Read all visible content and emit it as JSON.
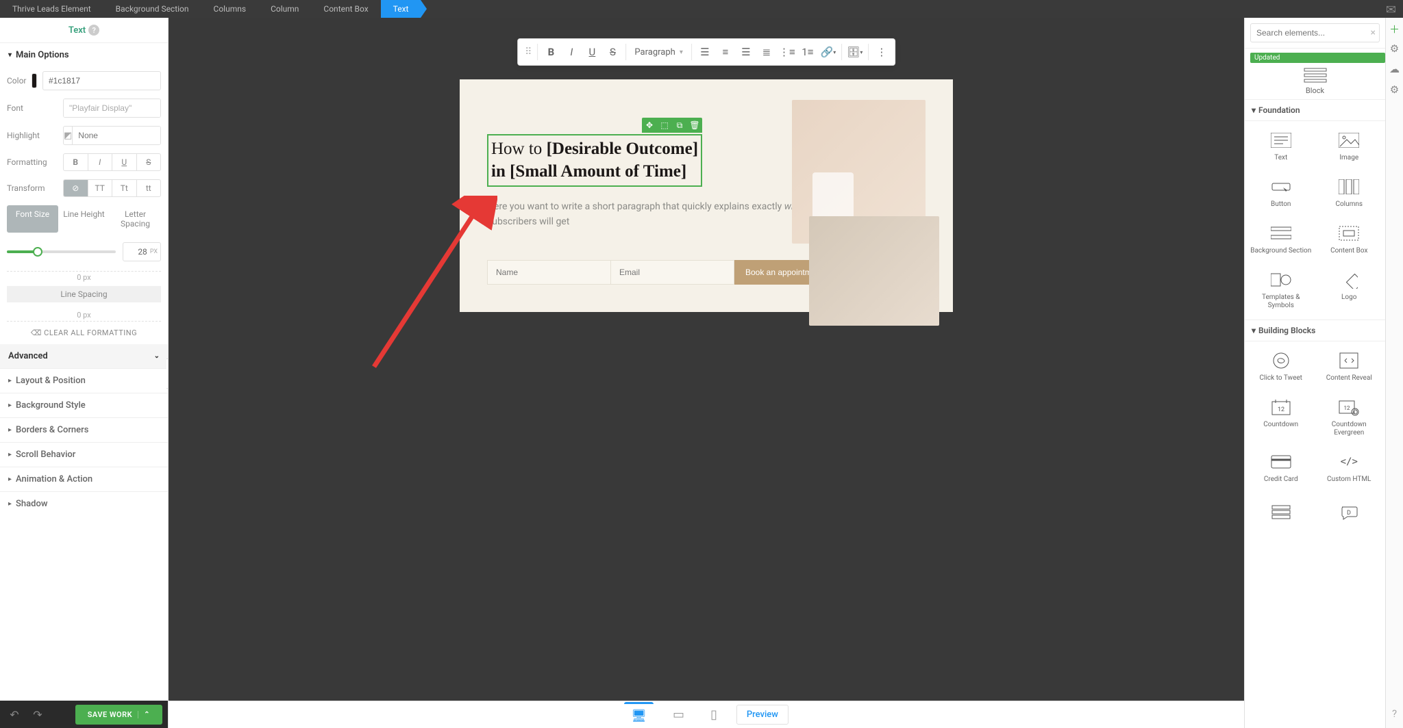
{
  "breadcrumb": [
    "Thrive Leads Element",
    "Background Section",
    "Columns",
    "Column",
    "Content Box",
    "Text"
  ],
  "left": {
    "title": "Text",
    "main_options": "Main Options",
    "props": {
      "color_label": "Color",
      "color_value": "#1c1817",
      "color_swatch": "#1c1817",
      "font_label": "Font",
      "font_value": "\"Playfair Display\"",
      "highlight_label": "Highlight",
      "highlight_placeholder": "None",
      "formatting_label": "Formatting",
      "transform_label": "Transform",
      "transform_opts": [
        "⊘",
        "TT",
        "Tt",
        "tt"
      ]
    },
    "tabs": {
      "font_size": "Font Size",
      "line_height": "Line Height",
      "letter_spacing": "Letter Spacing"
    },
    "font_size_value": "28",
    "font_size_unit": "PX",
    "line_spacing_top": "0 px",
    "line_spacing_lbl": "Line Spacing",
    "line_spacing_bottom": "0 px",
    "clear_fmt": "CLEAR ALL FORMATTING",
    "advanced": "Advanced",
    "sections": [
      "Layout & Position",
      "Background Style",
      "Borders & Corners",
      "Scroll Behavior",
      "Animation & Action",
      "Shadow"
    ]
  },
  "save_btn": "SAVE WORK",
  "toolbar": {
    "paragraph": "Paragraph"
  },
  "canvas": {
    "headline_1": "How to ",
    "headline_2": "[Desirable Outcome]",
    "headline_3": "in [Small Amount of Time]",
    "sub_pre": "Here you want to write a short paragraph that quickly explains exactly ",
    "sub_em": "what",
    "sub_post": " your subscribers will get",
    "name_ph": "Name",
    "email_ph": "Email",
    "book_btn": "Book an appointment"
  },
  "bottom": {
    "preview": "Preview"
  },
  "right": {
    "search_ph": "Search elements...",
    "updated": "Updated",
    "block": "Block",
    "foundation_hdr": "Foundation",
    "foundation": [
      "Text",
      "Image",
      "Button",
      "Columns",
      "Background Section",
      "Content Box",
      "Templates & Symbols",
      "Logo"
    ],
    "building_hdr": "Building Blocks",
    "building": [
      "Click to Tweet",
      "Content Reveal",
      "Countdown",
      "Countdown Evergreen",
      "Credit Card",
      "Custom HTML"
    ]
  }
}
